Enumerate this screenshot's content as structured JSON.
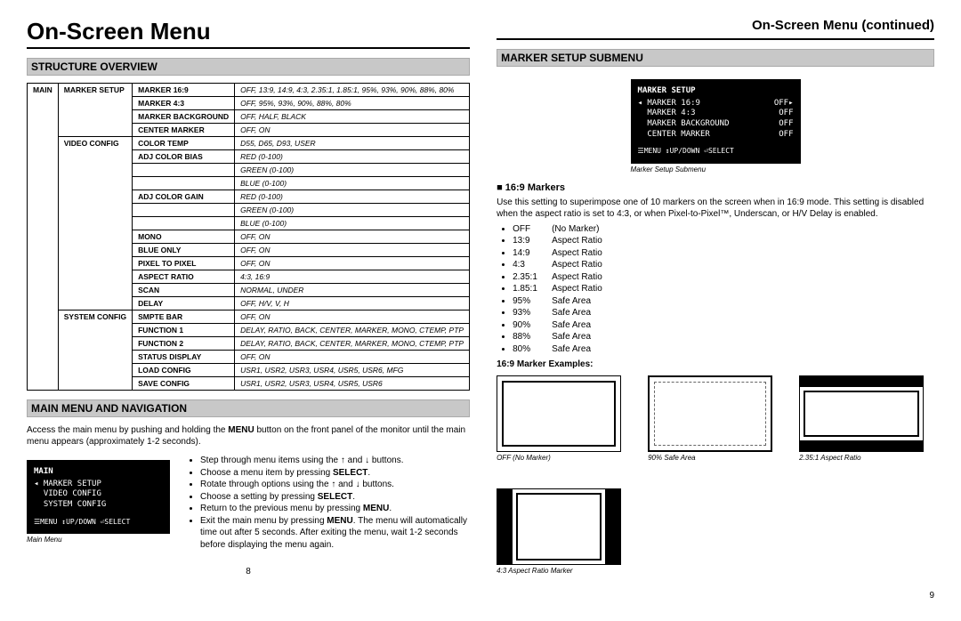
{
  "left": {
    "title": "On-Screen Menu",
    "h_structure": "Structure Overview",
    "h_nav": "Main Menu and Navigation",
    "nav_intro_a": "Access the main menu by pushing and holding the ",
    "nav_intro_b": " button on the front panel of the monitor until the main menu appears (approximately 1-2 seconds).",
    "menu_word": "MENU",
    "main_menu": {
      "header": "MAIN",
      "items": [
        "MARKER SETUP",
        "VIDEO CONFIG",
        "SYSTEM CONFIG"
      ],
      "footer": "☰MENU ↕UP/DOWN ⏎SELECT",
      "caption": "Main Menu"
    },
    "nav_steps": {
      "l1a": "Step through menu items using the ↑ and ↓ buttons.",
      "l2a": "Choose a menu item by pressing ",
      "l2b": "SELECT",
      "l2c": ".",
      "l3a": "Rotate through options using the ↑ and ↓ buttons.",
      "l4a": "Choose a setting by pressing ",
      "l4b": "SELECT",
      "l4c": ".",
      "l5a": "Return to the previous menu by pressing ",
      "l5b": "MENU",
      "l5c": ".",
      "l6a": "Exit the main menu by pressing ",
      "l6b": "MENU",
      "l6c": ". The menu will automatically time out after 5 seconds. After exiting the menu, wait 1-2 seconds before displaying the menu again."
    },
    "table": {
      "root": "MAIN",
      "groups": [
        {
          "name": "MARKER SETUP",
          "rows": [
            {
              "k": "MARKER 16:9",
              "v": "OFF, 13:9, 14:9, 4:3, 2.35:1, 1.85:1, 95%, 93%, 90%, 88%, 80%"
            },
            {
              "k": "MARKER 4:3",
              "v": "OFF, 95%, 93%, 90%, 88%, 80%"
            },
            {
              "k": "MARKER BACKGROUND",
              "v": "OFF, HALF, BLACK"
            },
            {
              "k": "CENTER MARKER",
              "v": "OFF, ON"
            }
          ]
        },
        {
          "name": "VIDEO CONFIG",
          "rows": [
            {
              "k": "COLOR TEMP",
              "v": "D55, D65, D93, USER"
            },
            {
              "k": "ADJ COLOR BIAS",
              "v": "RED (0-100)"
            },
            {
              "k": "",
              "v": "GREEN (0-100)"
            },
            {
              "k": "",
              "v": "BLUE (0-100)"
            },
            {
              "k": "ADJ COLOR GAIN",
              "v": "RED (0-100)"
            },
            {
              "k": "",
              "v": "GREEN (0-100)"
            },
            {
              "k": "",
              "v": "BLUE (0-100)"
            },
            {
              "k": "MONO",
              "v": "OFF, ON"
            },
            {
              "k": "BLUE ONLY",
              "v": "OFF, ON"
            },
            {
              "k": "PIXEL TO PIXEL",
              "v": "OFF, ON"
            },
            {
              "k": "ASPECT RATIO",
              "v": "4:3, 16:9"
            },
            {
              "k": "SCAN",
              "v": "NORMAL, UNDER"
            },
            {
              "k": "DELAY",
              "v": "OFF, H/V, V, H"
            }
          ]
        },
        {
          "name": "SYSTEM CONFIG",
          "rows": [
            {
              "k": "SMPTE BAR",
              "v": "OFF, ON"
            },
            {
              "k": "FUNCTION 1",
              "v": "DELAY, RATIO, BACK, CENTER, MARKER, MONO, CTEMP, PTP"
            },
            {
              "k": "FUNCTION 2",
              "v": "DELAY, RATIO, BACK, CENTER, MARKER, MONO, CTEMP, PTP"
            },
            {
              "k": "STATUS DISPLAY",
              "v": "OFF, ON"
            },
            {
              "k": "LOAD CONFIG",
              "v": "USR1, USR2, USR3, USR4, USR5, USR6, MFG"
            },
            {
              "k": "SAVE CONFIG",
              "v": "USR1, USR2, USR3, USR4, USR5, USR6"
            }
          ]
        }
      ]
    },
    "pagenum": "8"
  },
  "right": {
    "title": "On-Screen Menu (continued)",
    "h_marker": "Marker Setup Submenu",
    "submenu": {
      "header": "MARKER SETUP",
      "rows": [
        {
          "k": "MARKER 16:9",
          "v": "OFF▸"
        },
        {
          "k": "MARKER 4:3",
          "v": "OFF"
        },
        {
          "k": "MARKER BACKGROUND",
          "v": "OFF"
        },
        {
          "k": "CENTER MARKER",
          "v": "OFF"
        }
      ],
      "footer": "☰MENU ↕UP/DOWN ⏎SELECT",
      "caption": "Marker Setup Submenu"
    },
    "h_169": "16:9 Markers",
    "desc": "Use this setting to superimpose one of 10 markers on the screen when in 16:9 mode. This setting is disabled when the aspect ratio is set to 4:3, or when Pixel-to-Pixel™, Underscan, or H/V Delay is enabled.",
    "markers": [
      {
        "v": "OFF",
        "t": "(No Marker)"
      },
      {
        "v": "13:9",
        "t": "Aspect Ratio"
      },
      {
        "v": "14:9",
        "t": "Aspect Ratio"
      },
      {
        "v": "4:3",
        "t": "Aspect Ratio"
      },
      {
        "v": "2.35:1",
        "t": "Aspect Ratio"
      },
      {
        "v": "1.85:1",
        "t": "Aspect Ratio"
      },
      {
        "v": "95%",
        "t": "Safe Area"
      },
      {
        "v": "93%",
        "t": "Safe Area"
      },
      {
        "v": "90%",
        "t": "Safe Area"
      },
      {
        "v": "88%",
        "t": "Safe Area"
      },
      {
        "v": "80%",
        "t": "Safe Area"
      }
    ],
    "examples_h": "16:9 Marker Examples:",
    "examples": [
      "OFF (No Marker)",
      "90% Safe Area",
      "2.35:1 Aspect Ratio",
      "4:3 Aspect Ratio Marker"
    ],
    "pagenum": "9"
  }
}
